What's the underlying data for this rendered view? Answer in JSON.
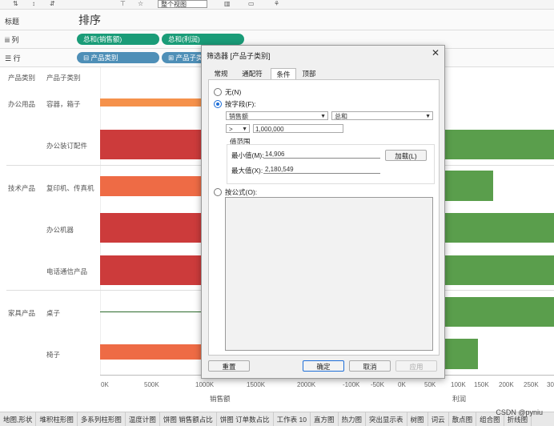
{
  "toolbar": {
    "view_select": "整个视图"
  },
  "shelves": {
    "title_label": "标题",
    "title_value": "排序",
    "columns_label": "iii 列",
    "columns_pills": [
      "总和(销售额)",
      "总和(利润)"
    ],
    "rows_label": "☰ 行",
    "rows_pills": [
      "⊟ 产品类别",
      "⊞ 产品子类"
    ]
  },
  "viz": {
    "headers": [
      "产品类别",
      "产品子类别"
    ],
    "categories": [
      "办公用品",
      "技术产品",
      "家具产品"
    ],
    "subcategories": [
      "容器，箱子",
      "办公装订配件",
      "复印机、传真机",
      "办公机器",
      "电话通信产品",
      "桌子",
      "椅子"
    ],
    "sales_axis": {
      "title": "销售额",
      "ticks": [
        "0K",
        "500K",
        "1000K",
        "1500K",
        "2000K"
      ]
    },
    "profit_axis": {
      "title": "利润",
      "ticks": [
        "-100K",
        "-50K",
        "0K",
        "50K",
        "100K",
        "150K",
        "200K",
        "250K",
        "30"
      ]
    },
    "colors": {
      "orange": "#f5914b",
      "coral": "#ee6b45",
      "red": "#cc3b3b",
      "green": "#5a9e4c"
    }
  },
  "chart_data": {
    "type": "bar",
    "categories": [
      "容器，箱子",
      "办公装订配件",
      "复印机、传真机",
      "办公机器",
      "电话通信产品",
      "桌子",
      "椅子"
    ],
    "series": [
      {
        "name": "销售额",
        "values": [
          950000,
          2180549,
          1000000,
          2180549,
          2180549,
          14906,
          1000000
        ]
      },
      {
        "name": "利润",
        "values": [
          0,
          300000,
          155000,
          300000,
          300000,
          300000,
          120000
        ]
      }
    ],
    "xlabel": "销售额"
  },
  "tabs": [
    "地图,形状",
    "堆积柱形图",
    "多系列柱形图",
    "温度计图",
    "饼图 销售额占比",
    "饼图 订单数占比",
    "工作表 10",
    "直方图",
    "热力图",
    "突出显示表",
    "树图",
    "词云",
    "散点图",
    "组合图",
    "折线图"
  ],
  "watermark": "CSDN @pyniu",
  "dialog": {
    "title": "筛选器 [产品子类别]",
    "close": "✕",
    "tabs": [
      "常规",
      "通配符",
      "条件",
      "顶部"
    ],
    "active_tab": "条件",
    "none_label": "无(N)",
    "by_field_label": "按字段(F):",
    "field_value": "销售额",
    "agg_value": "总和",
    "operator": ">",
    "threshold": "1,000,000",
    "range_title": "值范围",
    "min_label": "最小值(M):",
    "min_value": "14,906",
    "max_label": "最大值(X):",
    "max_value": "2,180,549",
    "load_button": "加载(L)",
    "formula_label": "按公式(O):",
    "reset_button": "重置",
    "ok_button": "确定",
    "cancel_button": "取消",
    "apply_button": "应用"
  }
}
